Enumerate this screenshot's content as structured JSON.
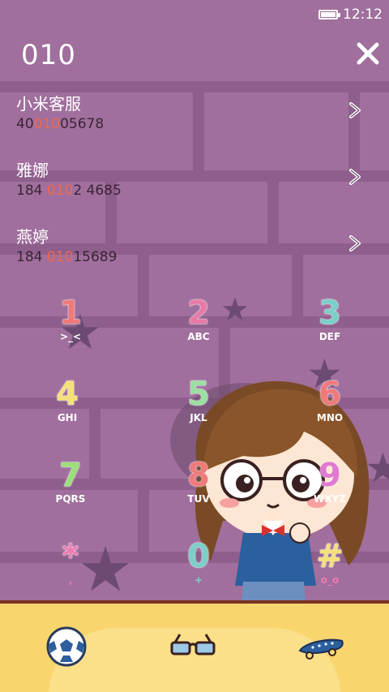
{
  "status": {
    "time": "12:12",
    "battery_icon": "battery-icon"
  },
  "dialer": {
    "input": "010",
    "close_icon": "close-icon"
  },
  "contacts": [
    {
      "name": "小米客服",
      "number_pre": "40",
      "number_hl": "010",
      "number_post": "05678"
    },
    {
      "name": "雅娜",
      "number_pre": "184 ",
      "number_hl": "010",
      "number_post": "2 4685"
    },
    {
      "name": "燕婷",
      "number_pre": "184 ",
      "number_hl": "010",
      "number_post": "15689"
    }
  ],
  "keypad": [
    {
      "digit": "1",
      "letters": ">_<",
      "color": "#f07a7a"
    },
    {
      "digit": "2",
      "letters": "ABC",
      "color": "#e97aa6"
    },
    {
      "digit": "3",
      "letters": "DEF",
      "color": "#7ad0c8"
    },
    {
      "digit": "4",
      "letters": "GHI",
      "color": "#f5e07a"
    },
    {
      "digit": "5",
      "letters": "JKL",
      "color": "#9ae0a0"
    },
    {
      "digit": "6",
      "letters": "MNO",
      "color": "#f07a7a"
    },
    {
      "digit": "7",
      "letters": "PQRS",
      "color": "#9ae07a"
    },
    {
      "digit": "8",
      "letters": "TUV",
      "color": "#f07a7a"
    },
    {
      "digit": "9",
      "letters": "WXYZ",
      "color": "#e07ad0"
    },
    {
      "digit": "*",
      "letters": ",",
      "color": "#f07ab0"
    },
    {
      "digit": "0",
      "letters": "+",
      "color": "#7ad0c8"
    },
    {
      "digit": "#",
      "letters": "o_o",
      "color": "#f5e07a"
    }
  ],
  "dock": [
    {
      "name": "soccer-ball-icon"
    },
    {
      "name": "glasses-icon"
    },
    {
      "name": "skateboard-icon"
    }
  ]
}
